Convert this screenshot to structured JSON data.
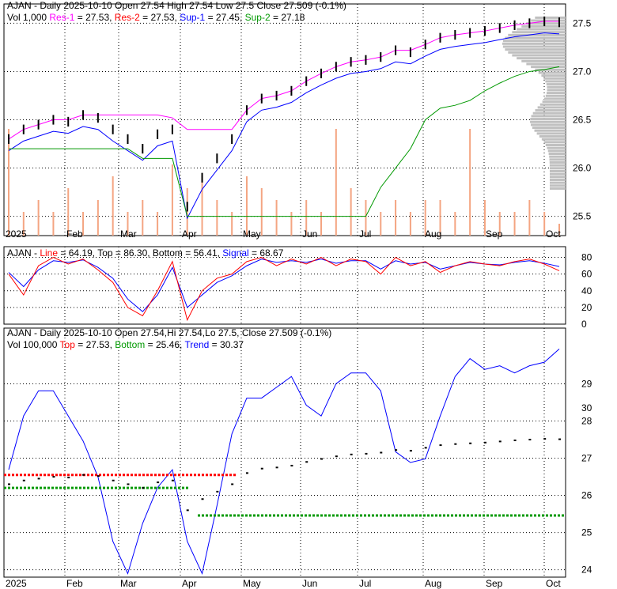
{
  "panel1": {
    "title": "AJAN - Daily 2025-10-10 Open 27.54  High 27.54  Low 27.5  Close 27.509 (-0.1%)",
    "vol": "Vol 1,000",
    "res1": "Res-1",
    "res1_val": " = 27.53,",
    "res2": "Res-2",
    "res2_val": " = 27.53,",
    "sup1": "Sup-1",
    "sup1_val": " = 27.45,",
    "sup2": "Sup-2",
    "sup2_val": " = 27.18"
  },
  "panel2": {
    "prefix": "AJAN - ",
    "line": "Line",
    "line_val": " = 64.19, Top = 86.30, Bottom = 56.41, ",
    "signal": "Signal",
    "signal_val": " = 68.67"
  },
  "panel3": {
    "title": "AJAN - Daily 2025-10-10 Open 27.54,Hi 27.54,Lo 27.5, Close 27.509 (-0.1%)",
    "vol": "Vol 100,000",
    "top": "Top",
    "top_val": " = 27.53, ",
    "bottom": "Bottom",
    "bottom_val": " = 25.46, ",
    "trend": "Trend",
    "trend_val": " = 30.37"
  },
  "colors": {
    "res1": "#ff00ff",
    "res2": "#ff0000",
    "sup1": "#0000ff",
    "sup2": "#009900",
    "volume": "#f4a582",
    "profile": "#c0c0c0"
  },
  "chart_data": [
    {
      "type": "line",
      "title": "AJAN - Daily price with support/resistance",
      "x_labels": [
        "2025",
        "Feb",
        "Mar",
        "Apr",
        "May",
        "Jun",
        "Jul",
        "Aug",
        "Sep",
        "Oct"
      ],
      "y_ticks": [
        25.5,
        26.0,
        26.5,
        27.0,
        27.5
      ],
      "y_tick_labels": [
        "25.5",
        "26.0",
        "26.5",
        "27.0",
        "27.5"
      ],
      "ylim": [
        25.3,
        27.7
      ],
      "close": [
        26.3,
        26.4,
        26.45,
        26.5,
        26.48,
        26.55,
        26.52,
        26.4,
        26.3,
        26.2,
        26.35,
        26.4,
        25.6,
        25.9,
        26.1,
        26.3,
        26.6,
        26.72,
        26.75,
        26.8,
        26.9,
        26.98,
        27.05,
        27.1,
        27.12,
        27.15,
        27.22,
        27.2,
        27.28,
        27.35,
        27.38,
        27.4,
        27.42,
        27.45,
        27.48,
        27.5,
        27.52,
        27.51
      ],
      "volume": [
        0.9,
        0.2,
        0.3,
        0.2,
        0.4,
        0.2,
        0.3,
        0.5,
        0.2,
        0.3,
        0.2,
        0.6,
        0.4,
        0.5,
        0.3,
        0.2,
        0.5,
        0.4,
        0.3,
        0.2,
        0.3,
        0.2,
        0.9,
        0.4,
        0.3,
        0.2,
        0.3,
        0.2,
        0.3,
        0.3,
        0.2,
        0.9,
        0.3,
        0.2,
        0.2,
        0.3,
        0.2,
        0.1
      ]
    },
    {
      "type": "line",
      "title": "Stochastic",
      "y_ticks": [
        0,
        20,
        40,
        60,
        80
      ],
      "y_tick_labels": [
        "0",
        "20",
        "40",
        "60",
        "80"
      ],
      "ylim": [
        0,
        90
      ],
      "line": [
        60,
        35,
        70,
        80,
        72,
        78,
        65,
        50,
        20,
        10,
        40,
        75,
        5,
        40,
        55,
        60,
        75,
        80,
        70,
        78,
        72,
        80,
        70,
        78,
        75,
        60,
        80,
        70,
        75,
        62,
        70,
        75,
        72,
        70,
        75,
        78,
        72,
        64
      ],
      "signal": [
        62,
        45,
        65,
        76,
        74,
        77,
        68,
        55,
        30,
        15,
        35,
        68,
        20,
        35,
        50,
        58,
        70,
        78,
        74,
        76,
        74,
        78,
        73,
        76,
        76,
        66,
        76,
        72,
        74,
        66,
        70,
        74,
        72,
        71,
        74,
        76,
        73,
        69
      ]
    },
    {
      "type": "line",
      "title": "Price with trend",
      "y_ticks": [
        24,
        25,
        26,
        27,
        28,
        29
      ],
      "y_tick_labels": [
        "24",
        "25",
        "26",
        "27",
        "28",
        "29",
        "30"
      ],
      "ylim": [
        23.8,
        29.5
      ],
      "trend": [
        27,
        28.5,
        29.2,
        29.2,
        28.5,
        27.8,
        26.8,
        25,
        24.1,
        25.5,
        26.5,
        27,
        25,
        24.1,
        26,
        28,
        29,
        29,
        29.3,
        29.6,
        28.8,
        28.5,
        29.4,
        29.7,
        29.7,
        29.2,
        27.5,
        27.2,
        27.3,
        28.5,
        29.6,
        30.1,
        29.8,
        29.9,
        29.7,
        29.9,
        30,
        30.37
      ]
    }
  ]
}
